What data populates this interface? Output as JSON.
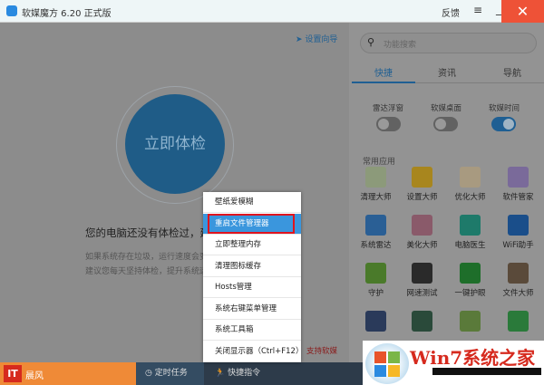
{
  "titlebar": {
    "title": "软媒魔方 6.20 正式版",
    "feedback": "反馈",
    "menu_icon": "hamburger-icon",
    "minimize_icon": "minimize-icon",
    "close_icon": "close-icon",
    "close_glyph": "✕"
  },
  "main": {
    "guide": "设置向导",
    "check_button": "立即体检",
    "message": "您的电脑还没有体检过，建",
    "sub1": "如果系统存在垃圾，运行速度会变慢",
    "sub2": "建议您每天坚持体检，提升系统运行",
    "support": "支持软媒"
  },
  "right": {
    "search_placeholder": "功能搜索",
    "tabs": [
      "快捷",
      "资讯",
      "导航"
    ],
    "active_tab": "快捷",
    "toggles": [
      {
        "label": "雷达浮窗",
        "on": false
      },
      {
        "label": "软媒桌面",
        "on": false
      },
      {
        "label": "软媒时间",
        "on": true
      }
    ],
    "apps_heading": "常用应用",
    "apps": [
      {
        "label": "清理大师",
        "color": "#8c9a7a"
      },
      {
        "label": "设置大师",
        "color": "#a8861e"
      },
      {
        "label": "优化大师",
        "color": "#a89a80"
      },
      {
        "label": "软件管家",
        "color": "#7a6a9a"
      },
      {
        "label": "系统雷达",
        "color": "#2a5f95"
      },
      {
        "label": "美化大师",
        "color": "#8a5a6a"
      },
      {
        "label": "电脑医生",
        "color": "#1e7a6a"
      },
      {
        "label": "WiFi助手",
        "color": "#1a4e8a"
      },
      {
        "label": "守护",
        "color": "#4a7a2a"
      },
      {
        "label": "网速测试",
        "color": "#2a2a2a"
      },
      {
        "label": "一键护眼",
        "color": "#1e6e2a"
      },
      {
        "label": "文件大师",
        "color": "#5a4a3a"
      },
      {
        "label": "",
        "color": "#2a3a5a"
      },
      {
        "label": "",
        "color": "#2a4a3a"
      },
      {
        "label": "",
        "color": "#5a7a3a"
      },
      {
        "label": "",
        "color": "#2a7a3a"
      }
    ]
  },
  "context_menu": {
    "items": [
      "壁纸爱模糊",
      "重启文件管理器",
      "立即整理内存",
      "清理图标缓存",
      "Hosts管理",
      "系统右键菜单管理",
      "系统工具箱",
      "关闭显示器（Ctrl+F12）"
    ],
    "highlighted": "重启文件管理器"
  },
  "bottom": {
    "user": "晨风",
    "logo": "IT",
    "timer": "定时任务",
    "commands": "快捷指令"
  },
  "watermark": {
    "text": "Win7系统之家"
  }
}
